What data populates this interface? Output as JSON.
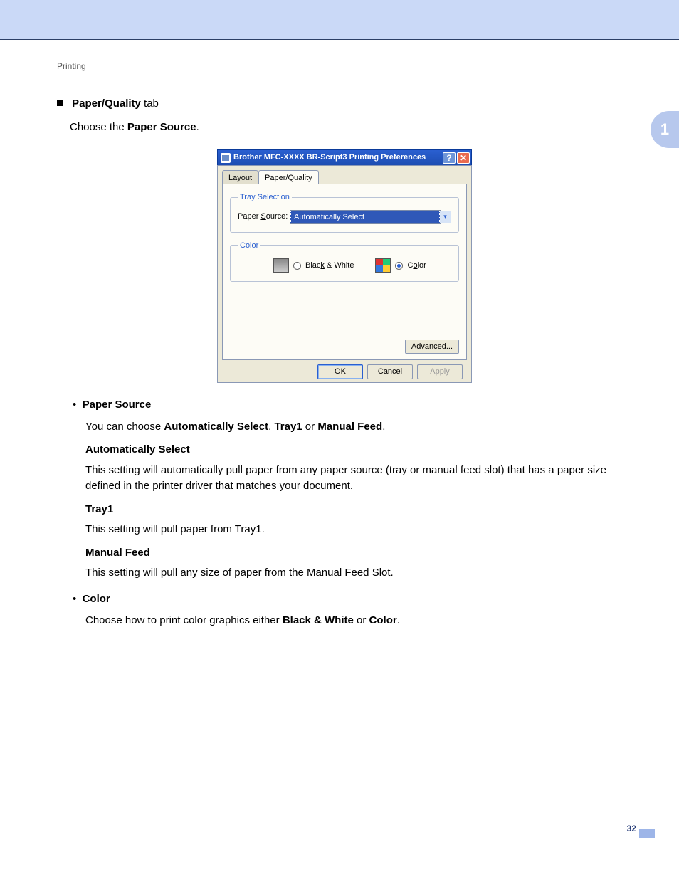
{
  "header": {
    "section": "Printing"
  },
  "sideTab": {
    "num": "1"
  },
  "intro": {
    "bulletTitleBold": "Paper/Quality",
    "bulletTitleTail": " tab",
    "chooseLine_pre": "Choose the ",
    "chooseLine_bold": "Paper Source",
    "chooseLine_post": "."
  },
  "dialog": {
    "title": "Brother MFC-XXXX BR-Script3 Printing Preferences",
    "helpGlyph": "?",
    "closeGlyph": "✕",
    "tabs": {
      "layout": "Layout",
      "paperQuality": "Paper/Quality"
    },
    "tray": {
      "legend": "Tray Selection",
      "label": "Paper Source:",
      "value": "Automatically Select",
      "arrow": "▾"
    },
    "color": {
      "legend": "Color",
      "bwLabel": "Black & White",
      "clLabel": "Color"
    },
    "advanced": "Advanced...",
    "buttons": {
      "ok": "OK",
      "cancel": "Cancel",
      "apply": "Apply"
    }
  },
  "desc": {
    "paperSource": {
      "head": "Paper Source",
      "body_pre": "You can choose ",
      "auto": "Automatically Select",
      "sep1": ", ",
      "tray1": "Tray1",
      "or": " or ",
      "manual": "Manual Feed",
      "body_post": ".",
      "autoHead": "Automatically Select",
      "autoBody": "This setting will automatically pull paper from any paper source (tray or manual feed slot) that has a paper size defined in the printer driver that matches your document.",
      "tray1Head": "Tray1",
      "tray1Body": "This setting will pull paper from Tray1.",
      "manualHead": "Manual Feed",
      "manualBody": "This setting will pull any size of paper from the Manual Feed Slot."
    },
    "color": {
      "head": "Color",
      "body_pre": "Choose how to print color graphics either ",
      "bw": "Black & White",
      "or": " or ",
      "cl": "Color",
      "body_post": "."
    }
  },
  "pageNumber": "32"
}
